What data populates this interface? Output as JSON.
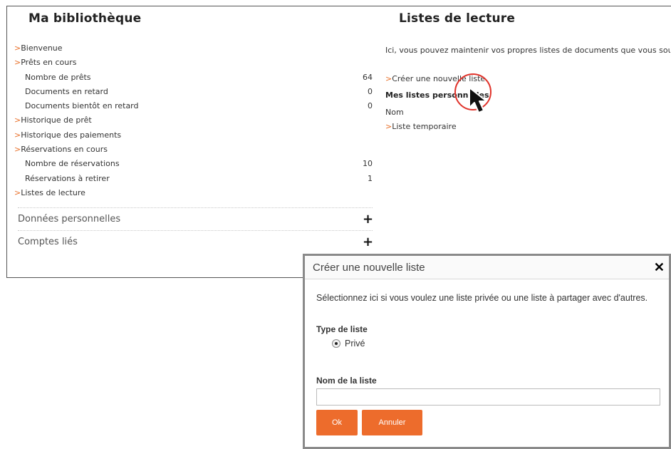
{
  "library": {
    "title": "Ma bibliothèque",
    "nav": [
      {
        "label": "Bienvenue",
        "link": true
      },
      {
        "label": "Prêts en cours",
        "link": true
      },
      {
        "label": "Nombre de prêts",
        "value": "64"
      },
      {
        "label": "Documents en retard",
        "value": "0"
      },
      {
        "label": "Documents bientôt en retard",
        "value": "0"
      },
      {
        "label": "Historique de prêt",
        "link": true
      },
      {
        "label": "Historique des paiements",
        "link": true
      },
      {
        "label": "Réservations en cours",
        "link": true
      },
      {
        "label": "Nombre de réservations",
        "value": "10"
      },
      {
        "label": "Réservations à retirer",
        "value": "1"
      },
      {
        "label": "Listes de lecture",
        "link": true
      }
    ],
    "chevron": ">",
    "accordion": [
      {
        "label": "Données personnelles",
        "icon": "+"
      },
      {
        "label": "Comptes liés",
        "icon": "+"
      }
    ]
  },
  "reading_lists": {
    "title": "Listes de lecture",
    "intro": "Ici, vous pouvez maintenir vos propres listes de documents que vous souhaitez",
    "create_link": "Créer une nouvelle liste",
    "personal_heading": "Mes listes personnelles",
    "col_name": "Nom",
    "temp_list": "Liste temporaire"
  },
  "modal": {
    "title": "Créer une nouvelle liste",
    "close": "✕",
    "description": "Sélectionnez ici si vous voulez une liste privée ou une liste à partager avec d'autres.",
    "type_label": "Type de liste",
    "radio_option": "Privé",
    "name_label": "Nom de la liste",
    "name_value": "",
    "ok": "Ok",
    "cancel": "Annuler"
  },
  "colors": {
    "accent": "#ed6c2c",
    "cursor_ring": "#e0332b"
  }
}
